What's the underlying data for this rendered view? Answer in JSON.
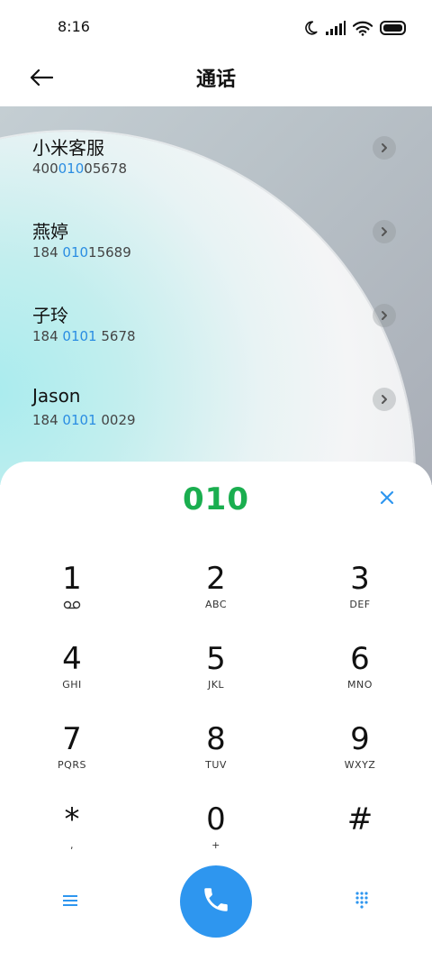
{
  "status_bar": {
    "time": "8:16",
    "icons": [
      "moon-icon",
      "signal-icon",
      "wifi-icon",
      "battery-icon"
    ]
  },
  "header": {
    "title": "通话",
    "back_icon": "arrow-left-icon"
  },
  "contacts": [
    {
      "name": "小米客服",
      "number_pre": "400",
      "number_hl": "010",
      "number_post": "05678"
    },
    {
      "name": "燕婷",
      "number_pre": "184 ",
      "number_hl": "010",
      "number_post": "15689"
    },
    {
      "name": "子玲",
      "number_pre": "184 ",
      "number_hl": "0101",
      "number_post": " 5678"
    },
    {
      "name": "Jason",
      "number_pre": "184 ",
      "number_hl": "0101",
      "number_post": " 0029"
    }
  ],
  "dialer": {
    "input": "010",
    "input_color": "#1aae4f",
    "accent": "#2e96ef",
    "highlight": "#2a8de2",
    "keys": [
      {
        "digit": "1",
        "sub": ""
      },
      {
        "digit": "2",
        "sub": "ABC"
      },
      {
        "digit": "3",
        "sub": "DEF"
      },
      {
        "digit": "4",
        "sub": "GHI"
      },
      {
        "digit": "5",
        "sub": "JKL"
      },
      {
        "digit": "6",
        "sub": "MNO"
      },
      {
        "digit": "7",
        "sub": "PQRS"
      },
      {
        "digit": "8",
        "sub": "TUV"
      },
      {
        "digit": "9",
        "sub": "WXYZ"
      },
      {
        "digit": "*",
        "sub": ","
      },
      {
        "digit": "0",
        "sub": "+"
      },
      {
        "digit": "#",
        "sub": ""
      }
    ]
  }
}
